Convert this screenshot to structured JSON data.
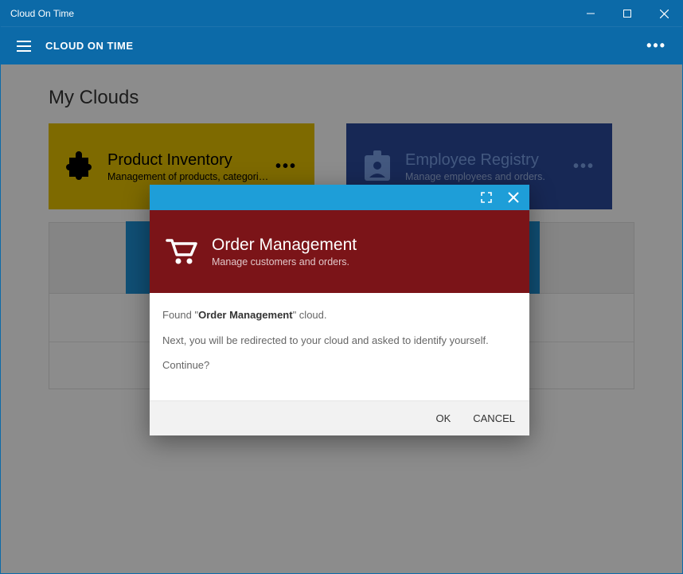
{
  "titlebar": {
    "title": "Cloud On Time"
  },
  "header": {
    "app_title": "CLOUD ON TIME"
  },
  "page": {
    "title": "My Clouds"
  },
  "cards": [
    {
      "title": "Product Inventory",
      "sub": "Management of products, categorie…",
      "icon": "puzzle-icon"
    },
    {
      "title": "Employee Registry",
      "sub": "Manage employees and orders.",
      "icon": "badge-icon"
    }
  ],
  "dialog": {
    "title": "Order Management",
    "sub": "Manage customers and orders.",
    "body_prefix": "Found \"",
    "body_cloud_name": "Order Management",
    "body_suffix": "\" cloud.",
    "body_line2": "Next, you will be redirected to your cloud and asked to identify yourself.",
    "body_line3": "Continue?",
    "ok_label": "OK",
    "cancel_label": "CANCEL"
  }
}
